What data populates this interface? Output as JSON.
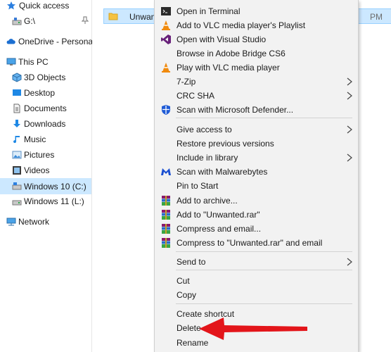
{
  "nav": {
    "items": [
      {
        "label": "Quick access",
        "icon": "star-icon"
      },
      {
        "label": "G:\\",
        "icon": "drive-icon"
      },
      {
        "label": "OneDrive - Personal",
        "icon": "cloud-icon"
      },
      {
        "label": "This PC",
        "icon": "computer-icon"
      },
      {
        "label": "3D Objects",
        "icon": "cube-icon"
      },
      {
        "label": "Desktop",
        "icon": "desktop-icon"
      },
      {
        "label": "Documents",
        "icon": "document-icon"
      },
      {
        "label": "Downloads",
        "icon": "download-icon"
      },
      {
        "label": "Music",
        "icon": "music-icon"
      },
      {
        "label": "Pictures",
        "icon": "pictures-icon"
      },
      {
        "label": "Videos",
        "icon": "video-icon"
      },
      {
        "label": "Windows 10 (C:)",
        "icon": "drive-icon"
      },
      {
        "label": "Windows 11 (L:)",
        "icon": "drive-icon"
      },
      {
        "label": "Network",
        "icon": "network-icon"
      }
    ]
  },
  "file": {
    "name": "Unwanted",
    "date_fragment": "PM"
  },
  "menu": {
    "open_terminal": "Open in Terminal",
    "add_vlc_playlist": "Add to VLC media player's Playlist",
    "open_visual_studio": "Open with Visual Studio",
    "browse_bridge": "Browse in Adobe Bridge CS6",
    "play_vlc": "Play with VLC media player",
    "seven_zip": "7-Zip",
    "crc_sha": "CRC SHA",
    "scan_defender": "Scan with Microsoft Defender...",
    "give_access": "Give access to",
    "restore_versions": "Restore previous versions",
    "include_library": "Include in library",
    "scan_malwarebytes": "Scan with Malwarebytes",
    "pin_start": "Pin to Start",
    "add_archive": "Add to archive...",
    "add_rar": "Add to \"Unwanted.rar\"",
    "compress_email": "Compress and email...",
    "compress_rar_email": "Compress to \"Unwanted.rar\" and email",
    "send_to": "Send to",
    "cut": "Cut",
    "copy": "Copy",
    "create_shortcut": "Create shortcut",
    "delete": "Delete",
    "rename": "Rename"
  },
  "colors": {
    "selection": "#cce8ff",
    "menu_bg": "#f2f2f2",
    "arrow": "#e3151a",
    "vlc_orange": "#f08a0e",
    "vs_purple": "#68217a",
    "defender_blue": "#1f5bd6",
    "malwarebytes_blue": "#1a4fd1"
  }
}
